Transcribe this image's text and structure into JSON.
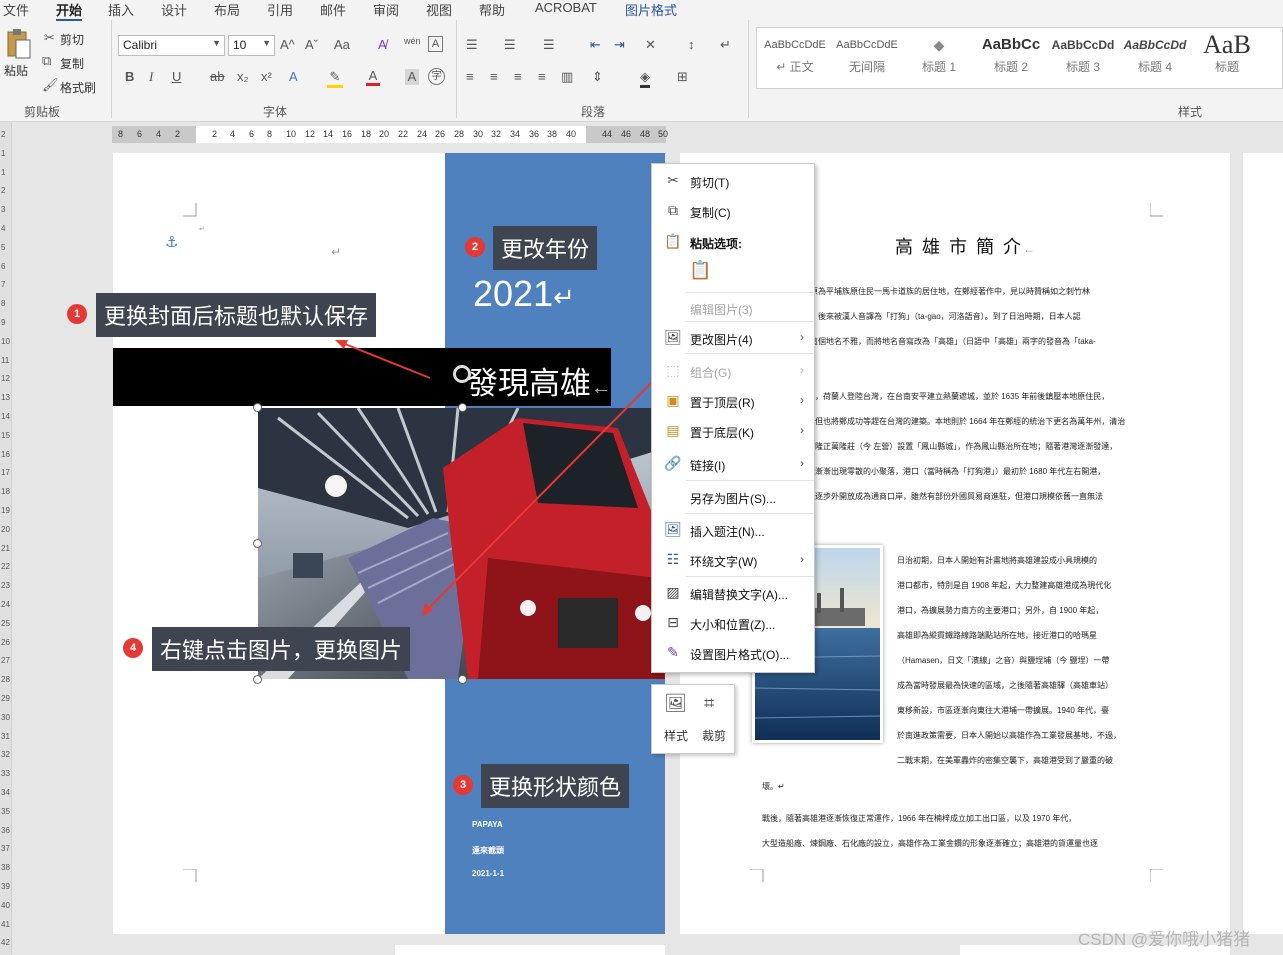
{
  "ribbon": {
    "tabs": [
      "文件",
      "开始",
      "插入",
      "设计",
      "布局",
      "引用",
      "邮件",
      "审阅",
      "视图",
      "帮助",
      "ACROBAT",
      "图片格式"
    ],
    "clipboard": {
      "paste": "粘贴",
      "cut": "剪切",
      "copy": "复制",
      "format_painter": "格式刷",
      "group": "剪贴板"
    },
    "font": {
      "name": "Calibri",
      "size": "10",
      "group": "字体",
      "change_case": "Aa",
      "phonetic": "wén"
    },
    "paragraph": {
      "group": "段落"
    },
    "styles": {
      "group": "样式",
      "items": [
        {
          "preview": "AaBbCcDdE",
          "name": "↵ 正文"
        },
        {
          "preview": "AaBbCcDdE",
          "name": "无间隔"
        },
        {
          "preview": "◆",
          "name": "标题 1"
        },
        {
          "preview": "AaBbCc",
          "name": "标题 2"
        },
        {
          "preview": "AaBbCcDd",
          "name": "标题 3"
        },
        {
          "preview": "AaBbCcDd",
          "name": "标题 4"
        },
        {
          "preview": "AaB",
          "name": "标题"
        }
      ]
    }
  },
  "ruler": {
    "marks": [
      "8",
      "6",
      "4",
      "2",
      "2",
      "4",
      "6",
      "8",
      "10",
      "12",
      "14",
      "16",
      "18",
      "20",
      "22",
      "24",
      "26",
      "28",
      "30",
      "32",
      "34",
      "36",
      "38",
      "40",
      "44",
      "46",
      "48",
      "50"
    ],
    "vmarks": [
      "2",
      "1",
      "1",
      "2",
      "3",
      "4",
      "5",
      "6",
      "7",
      "8",
      "9",
      "10",
      "11",
      "12",
      "13",
      "14",
      "15",
      "16",
      "17",
      "18",
      "19",
      "20",
      "21",
      "22",
      "23",
      "24",
      "25",
      "26",
      "27",
      "28",
      "29",
      "30",
      "31",
      "32",
      "33",
      "34",
      "35",
      "36",
      "37",
      "38",
      "39",
      "40",
      "41",
      "42"
    ]
  },
  "cover": {
    "year": "2021",
    "title": "發現高雄",
    "footer": [
      "PAPAYA",
      "遠來截頭",
      "2021-1-1"
    ],
    "return_mark": "↵"
  },
  "annotations": [
    {
      "num": "1",
      "text": "更换封面后标题也默认保存"
    },
    {
      "num": "2",
      "text": "更改年份"
    },
    {
      "num": "3",
      "text": "更换形状颜色"
    },
    {
      "num": "4",
      "text": "右键点击图片，更换图片"
    }
  ],
  "context_menu": {
    "items": [
      {
        "icon": "scissors-icon",
        "label": "剪切(T)"
      },
      {
        "icon": "copy-icon",
        "label": "复制(C)"
      },
      {
        "icon": "paste-icon",
        "label": "粘贴选项:"
      },
      {
        "icon": "",
        "label": "编辑图片(3)"
      },
      {
        "icon": "change-picture-icon",
        "label": "更改图片(4)"
      },
      {
        "icon": "group-icon",
        "label": "组合(G)"
      },
      {
        "icon": "bring-front-icon",
        "label": "置于顶层(R)"
      },
      {
        "icon": "send-back-icon",
        "label": "置于底层(K)"
      },
      {
        "icon": "link-icon",
        "label": "链接(I)"
      },
      {
        "icon": "",
        "label": "另存为图片(S)..."
      },
      {
        "icon": "caption-icon",
        "label": "插入题注(N)..."
      },
      {
        "icon": "wrap-text-icon",
        "label": "环绕文字(W)"
      },
      {
        "icon": "alt-text-icon",
        "label": "编辑替换文字(A)..."
      },
      {
        "icon": "size-position-icon",
        "label": "大小和位置(Z)..."
      },
      {
        "icon": "format-picture-icon",
        "label": "设置图片格式(O)..."
      }
    ]
  },
  "mini_toolbar": {
    "style": "样式",
    "crop": "裁剪"
  },
  "right_page": {
    "title": "高 雄 市 簡 介",
    "para1": [
      "原為平埔族原住民一馬卡道族的居住地，在鄭經著作中，見以時贊稱如之刺竹林",
      "，後來被漢人音譯為「打狗」（ta-gao，河洛語音）。到了日治時期，日本人認",
      "這個地名不雅，而將地名音寫改為「高雄」（日語中「高雄」兩字的發音為「taka-"
    ],
    "para2": [
      "，荷蘭人登陸台灣，在台南安平建立熱蘭遮城，並於 1635 年前後鎮壓本地原住民，",
      "但也將鄭成功等趕在台灣的建築。本地則於 1664 年在鄭經的統治下更名為萬年州，清治",
      "隆正萬隆莊（今 左營）設置「鳳山縣城」，作為鳳山縣治所在地；隨著港灣逐漸發達，",
      "漸漸出現零散的小聚落，港口（當時稱為「打狗港」）最初於 1680 年代左右開港，",
      "逐步外開放成為通商口岸，雖然有部份外國貿易商進駐，但港口規模依舊一直無法"
    ],
    "para3": [
      "日治初期，日本人開始有計畫地將高雄建設成小具規模的",
      "港口都市，特別是自 1908 年起，大力整建高雄港成為現代化",
      "港口，為擴展勢力南方的主要港口；另外，自 1900 年起，",
      "高雄即為縱貫鐵路線路端點站所在地，接近港口的哈瑪星",
      "（Hamasen，日文「濱線」之音）與鹽埕埔（今 鹽埕）一帶",
      "成為當時發展最為快速的區域，之後隨著高雄驛（高雄車站）",
      "東移新設，市區逐漸向東往大港埔一帶擴展。1940 年代，臺",
      "於南進政策需要，日本人開始以高雄作為工業發展基地，不過，",
      "二戰末期，在美軍轟炸的密集空襲下，高雄港受到了嚴重的破"
    ],
    "para3_end": "壞。↵",
    "para4": [
      "戰後，隨著高雄港逐漸恢復正常運作，1966 年在楠梓成立加工出口區，以及 1970 年代，",
      "大型造船廠、煉鋼廠、石化廠的設立，高雄作為工業金鑽的形象逐漸確立；高雄港的貨運量也逐"
    ]
  },
  "watermark": "CSDN @爱你哦小猪猪"
}
